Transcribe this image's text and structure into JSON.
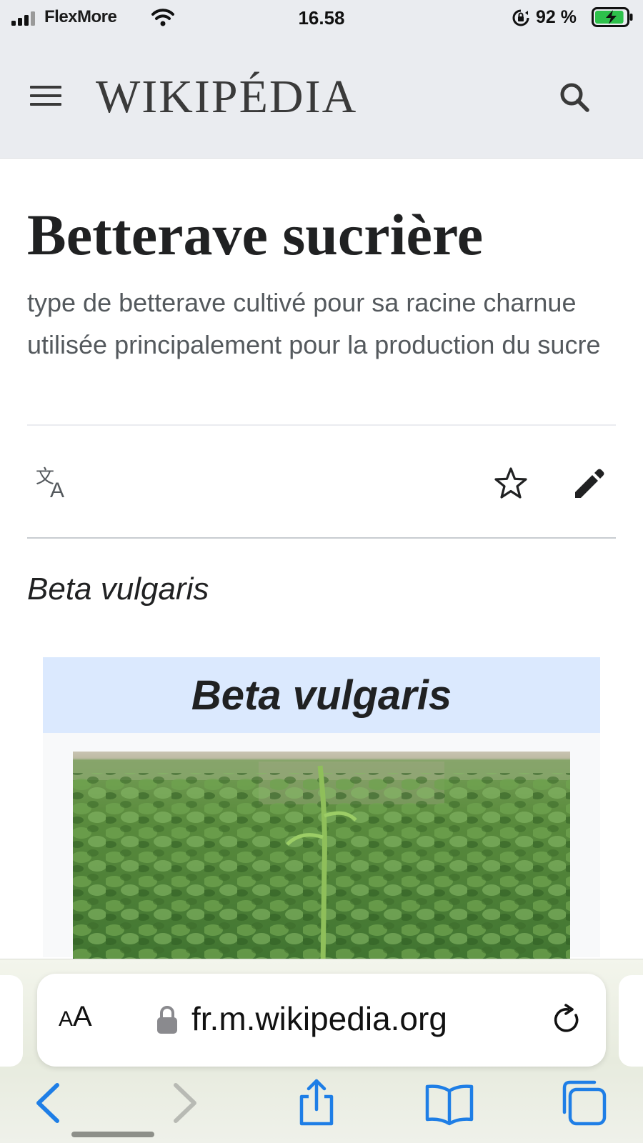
{
  "status_bar": {
    "carrier": "FlexMore",
    "time": "16.58",
    "battery_percent": "92 %",
    "battery_level": 0.92
  },
  "header": {
    "wordmark": "WIKIPÉDIA",
    "menu_icon": "hamburger-menu-icon",
    "search_icon": "search-icon"
  },
  "article": {
    "title": "Betterave sucrière",
    "description": "type de betterave cultivé pour sa racine charnue utilisée principalement pour la production du sucre",
    "scientific_name": "Beta vulgaris",
    "actions": {
      "language_icon": "translate-icon",
      "watch_icon": "star-icon",
      "edit_icon": "pencil-icon"
    }
  },
  "infobox": {
    "heading": "Beta vulgaris",
    "image_subject": "field of sugar beet plants"
  },
  "browser": {
    "text_size_label_small": "A",
    "text_size_label_big": "A",
    "url": "fr.m.wikipedia.org",
    "colors": {
      "toolbar_blue": "#1e7ee6",
      "disabled_gray": "#b8bab4"
    }
  }
}
